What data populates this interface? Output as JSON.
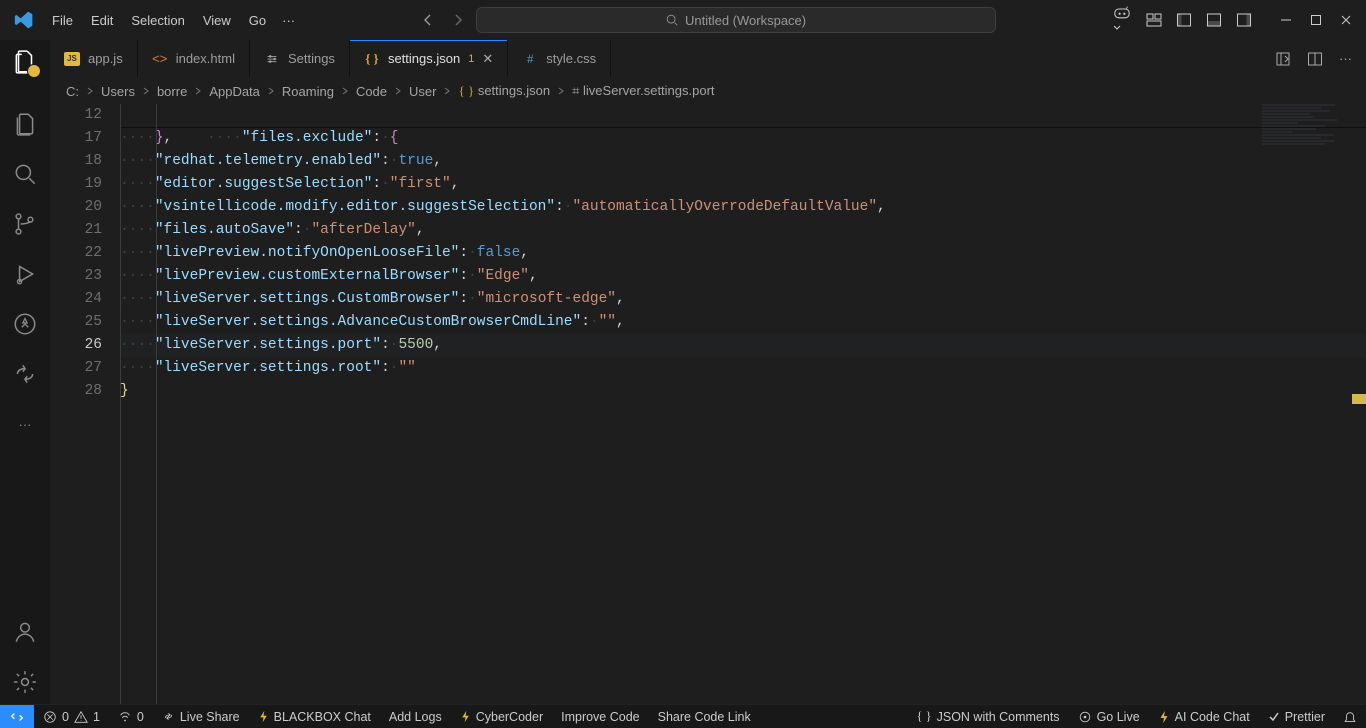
{
  "menu": [
    "File",
    "Edit",
    "Selection",
    "View",
    "Go"
  ],
  "search_placeholder": "Untitled (Workspace)",
  "tabs": [
    {
      "label": "app.js",
      "icon": "js"
    },
    {
      "label": "index.html",
      "icon": "html"
    },
    {
      "label": "Settings",
      "icon": "settings"
    },
    {
      "label": "settings.json",
      "icon": "json",
      "modified": "1",
      "active": true
    },
    {
      "label": "style.css",
      "icon": "css"
    }
  ],
  "breadcrumbs": [
    "C:",
    "Users",
    "borre",
    "AppData",
    "Roaming",
    "Code",
    "User",
    "settings.json",
    "liveServer.settings.port"
  ],
  "sticky": {
    "num": "12",
    "key": "\"files.exclude\"",
    "brace": "{"
  },
  "lines": [
    {
      "num": "17",
      "html": "<span class='dots'>····</span><span class='s-brace2'>}</span><span class='s-punc'>,</span>"
    },
    {
      "num": "18",
      "html": "<span class='dots'>····</span><span class='s-key'>\"redhat.telemetry.enabled\"</span><span class='s-punc'>:</span><span class='dots'>·</span><span class='s-bool'>true</span><span class='s-punc'>,</span>"
    },
    {
      "num": "19",
      "html": "<span class='dots'>····</span><span class='s-key'>\"editor.suggestSelection\"</span><span class='s-punc'>:</span><span class='dots'>·</span><span class='s-str'>\"first\"</span><span class='s-punc'>,</span>"
    },
    {
      "num": "20",
      "html": "<span class='dots'>····</span><span class='s-key'>\"vsintellicode.modify.editor.suggestSelection\"</span><span class='s-punc'>:</span><span class='dots'>·</span><span class='s-str'>\"automaticallyOverrodeDefaultValue\"</span><span class='s-punc'>,</span>"
    },
    {
      "num": "21",
      "html": "<span class='dots'>····</span><span class='s-key'>\"files.autoSave\"</span><span class='s-punc'>:</span><span class='dots'>·</span><span class='s-str'>\"afterDelay\"</span><span class='s-punc'>,</span>"
    },
    {
      "num": "22",
      "html": "<span class='dots'>····</span><span class='s-key'>\"livePreview.notifyOnOpenLooseFile\"</span><span class='s-punc'>:</span><span class='dots'>·</span><span class='s-bool'>false</span><span class='s-punc'>,</span>"
    },
    {
      "num": "23",
      "html": "<span class='dots'>····</span><span class='s-key'>\"livePreview.customExternalBrowser\"</span><span class='s-punc'>:</span><span class='dots'>·</span><span class='s-str'>\"Edge\"</span><span class='s-punc'>,</span>"
    },
    {
      "num": "24",
      "html": "<span class='dots'>····</span><span class='s-key'>\"liveServer.settings.CustomBrowser\"</span><span class='s-punc'>:</span><span class='dots'>·</span><span class='s-str'>\"microsoft-edge\"</span><span class='s-punc'>,</span>"
    },
    {
      "num": "25",
      "html": "<span class='dots'>····</span><span class='s-key'>\"liveServer.settings.AdvanceCustomBrowserCmdLine\"</span><span class='s-punc'>:</span><span class='dots'>·</span><span class='s-str'>\"\"</span><span class='s-punc'>,</span>"
    },
    {
      "num": "26",
      "html": "<span class='dots'>····</span><span class='s-key'>\"liveServer.settings.port\"</span><span class='s-punc'>:</span><span class='dots'>·</span><span class='s-num'>5500</span><span class='s-punc'>,</span>",
      "current": true
    },
    {
      "num": "27",
      "html": "<span class='dots'>····</span><span class='s-key'>\"liveServer.settings.root\"</span><span class='s-punc'>:</span><span class='dots'>·</span><span class='s-str'>\"\"</span>"
    },
    {
      "num": "28",
      "html": "<span class='s-brace'>}</span>"
    }
  ],
  "status": {
    "errors": "0",
    "warnings": "1",
    "ports": "0",
    "items_left": [
      "Live Share",
      "BLACKBOX Chat",
      "Add Logs",
      "CyberCoder",
      "Improve Code",
      "Share Code Link"
    ],
    "language": "JSON with Comments",
    "golive": "Go Live",
    "aichat": "AI Code Chat",
    "prettier": "Prettier"
  }
}
